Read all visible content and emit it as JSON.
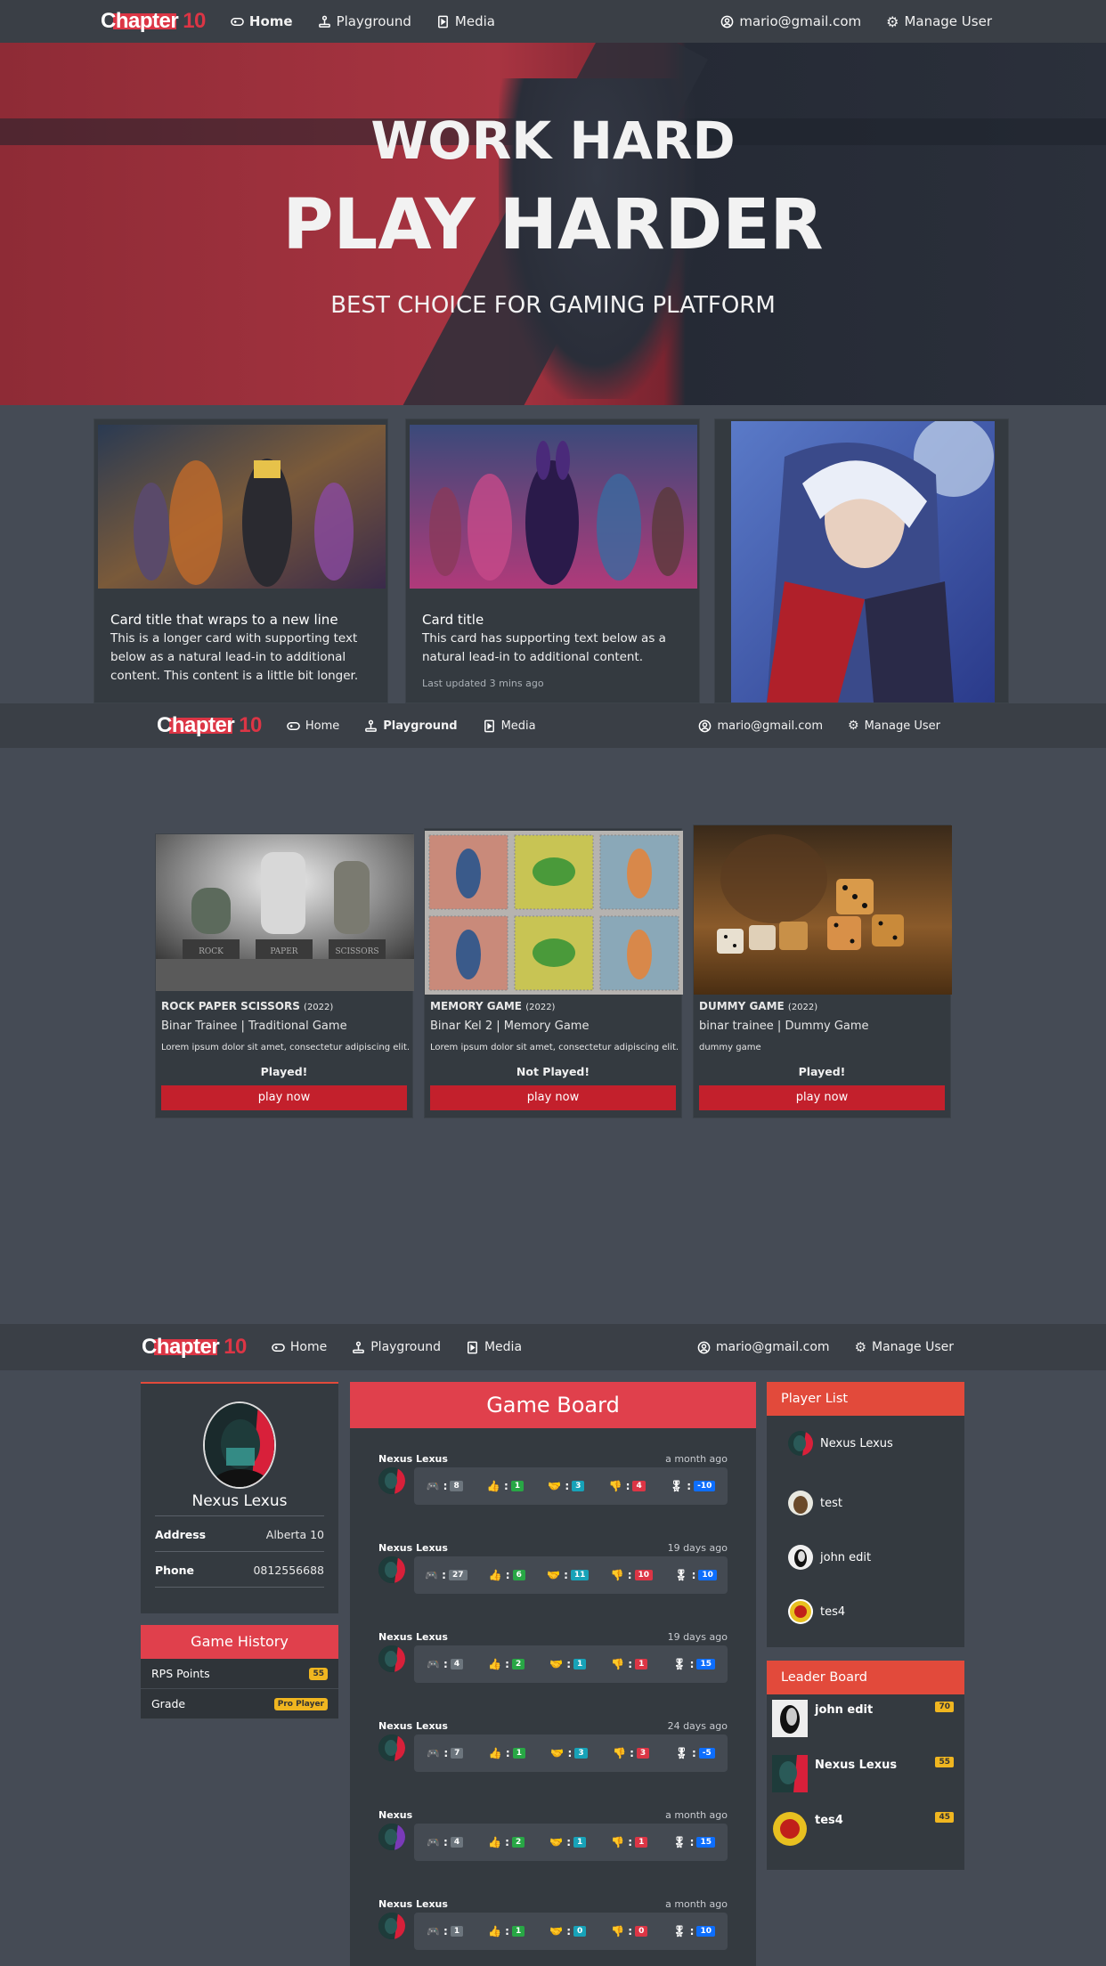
{
  "nav": {
    "brand_chapter": "Chapter",
    "brand_number": "10",
    "home": "Home",
    "playground": "Playground",
    "media": "Media",
    "email": "mario@gmail.com",
    "manage": "Manage User"
  },
  "hero": {
    "line1": "WORK HARD",
    "line2": "PLAY HARDER",
    "line3": "BEST CHOICE FOR GAMING PLATFORM"
  },
  "cards": [
    {
      "title": "Card title that wraps to a new line",
      "text": "This is a longer card with supporting text below as a natural lead-in to additional content. This content is a little bit longer."
    },
    {
      "title": "Card title",
      "text": "This card has supporting text below as a natural lead-in to additional content.",
      "muted": "Last updated 3 mins ago"
    }
  ],
  "games": [
    {
      "title": "ROCK PAPER SCISSORS",
      "year": "(2022)",
      "sub": "Binar Trainee | Traditional Game",
      "desc": "Lorem ipsum dolor sit amet, consectetur adipiscing elit.",
      "status": "Played!",
      "button": "play now",
      "labels": [
        "ROCK",
        "PAPER",
        "SCISSORS"
      ]
    },
    {
      "title": "MEMORY GAME",
      "year": "(2022)",
      "sub": "Binar Kel 2 | Memory Game",
      "desc": "Lorem ipsum dolor sit amet, consectetur adipiscing elit.",
      "status": "Not Played!",
      "button": "play now"
    },
    {
      "title": "DUMMY GAME",
      "year": "(2022)",
      "sub": "binar trainee | Dummy Game",
      "desc": "dummy game",
      "status": "Played!",
      "button": "play now"
    }
  ],
  "profile": {
    "name": "Nexus Lexus",
    "address_label": "Address",
    "address": "Alberta 10",
    "phone_label": "Phone",
    "phone": "0812556688"
  },
  "history": {
    "title": "Game History",
    "rows": [
      {
        "label": "RPS Points",
        "value": "55"
      },
      {
        "label": "Grade",
        "value": "Pro Player"
      }
    ]
  },
  "board": {
    "title": "Game Board",
    "items": [
      {
        "name": "Nexus Lexus",
        "time": "a month ago",
        "v": [
          "8",
          "1",
          "3",
          "4",
          "-10"
        ]
      },
      {
        "name": "Nexus Lexus",
        "time": "19 days ago",
        "v": [
          "27",
          "6",
          "11",
          "10",
          "10"
        ]
      },
      {
        "name": "Nexus Lexus",
        "time": "19 days ago",
        "v": [
          "4",
          "2",
          "1",
          "1",
          "15"
        ]
      },
      {
        "name": "Nexus Lexus",
        "time": "24 days ago",
        "v": [
          "7",
          "1",
          "3",
          "3",
          "-5"
        ]
      },
      {
        "name": "Nexus",
        "time": "a month ago",
        "v": [
          "4",
          "2",
          "1",
          "1",
          "15"
        ]
      },
      {
        "name": "Nexus Lexus",
        "time": "a month ago",
        "v": [
          "1",
          "1",
          "0",
          "0",
          "10"
        ]
      }
    ]
  },
  "players": {
    "title": "Player List",
    "list": [
      "Nexus Lexus",
      "test",
      "john edit",
      "tes4"
    ]
  },
  "leader": {
    "title": "Leader Board",
    "list": [
      {
        "name": "john edit",
        "score": "70"
      },
      {
        "name": "Nexus Lexus",
        "score": "55"
      },
      {
        "name": "tes4",
        "score": "45"
      }
    ]
  }
}
